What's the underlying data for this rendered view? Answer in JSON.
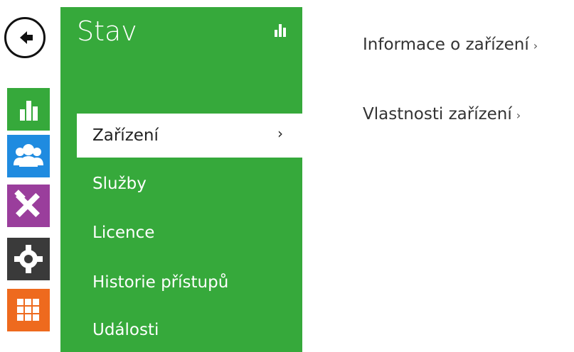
{
  "nav": {
    "back_icon": "back-arrow-icon",
    "tiles": [
      {
        "name": "status",
        "icon": "bar-chart-icon",
        "color": "#36a93b"
      },
      {
        "name": "users",
        "icon": "users-icon",
        "color": "#1f8be0"
      },
      {
        "name": "tools",
        "icon": "tools-icon",
        "color": "#9a3e9c"
      },
      {
        "name": "settings",
        "icon": "gear-icon",
        "color": "#3a3a3a"
      },
      {
        "name": "apps",
        "icon": "grid-icon",
        "color": "#ee6a1e"
      }
    ]
  },
  "panel": {
    "title": "Stav",
    "icon": "bar-chart-icon",
    "accent": "#36a93b",
    "items": [
      {
        "label": "Zařízení",
        "active": true,
        "chevron": "›"
      },
      {
        "label": "Služby"
      },
      {
        "label": "Licence"
      },
      {
        "label": "Historie přístupů"
      },
      {
        "label": "Události"
      }
    ]
  },
  "content": {
    "links": [
      {
        "label": "Informace o zařízení",
        "chevron": "›"
      },
      {
        "label": "Vlastnosti zařízení",
        "chevron": "›"
      }
    ]
  }
}
